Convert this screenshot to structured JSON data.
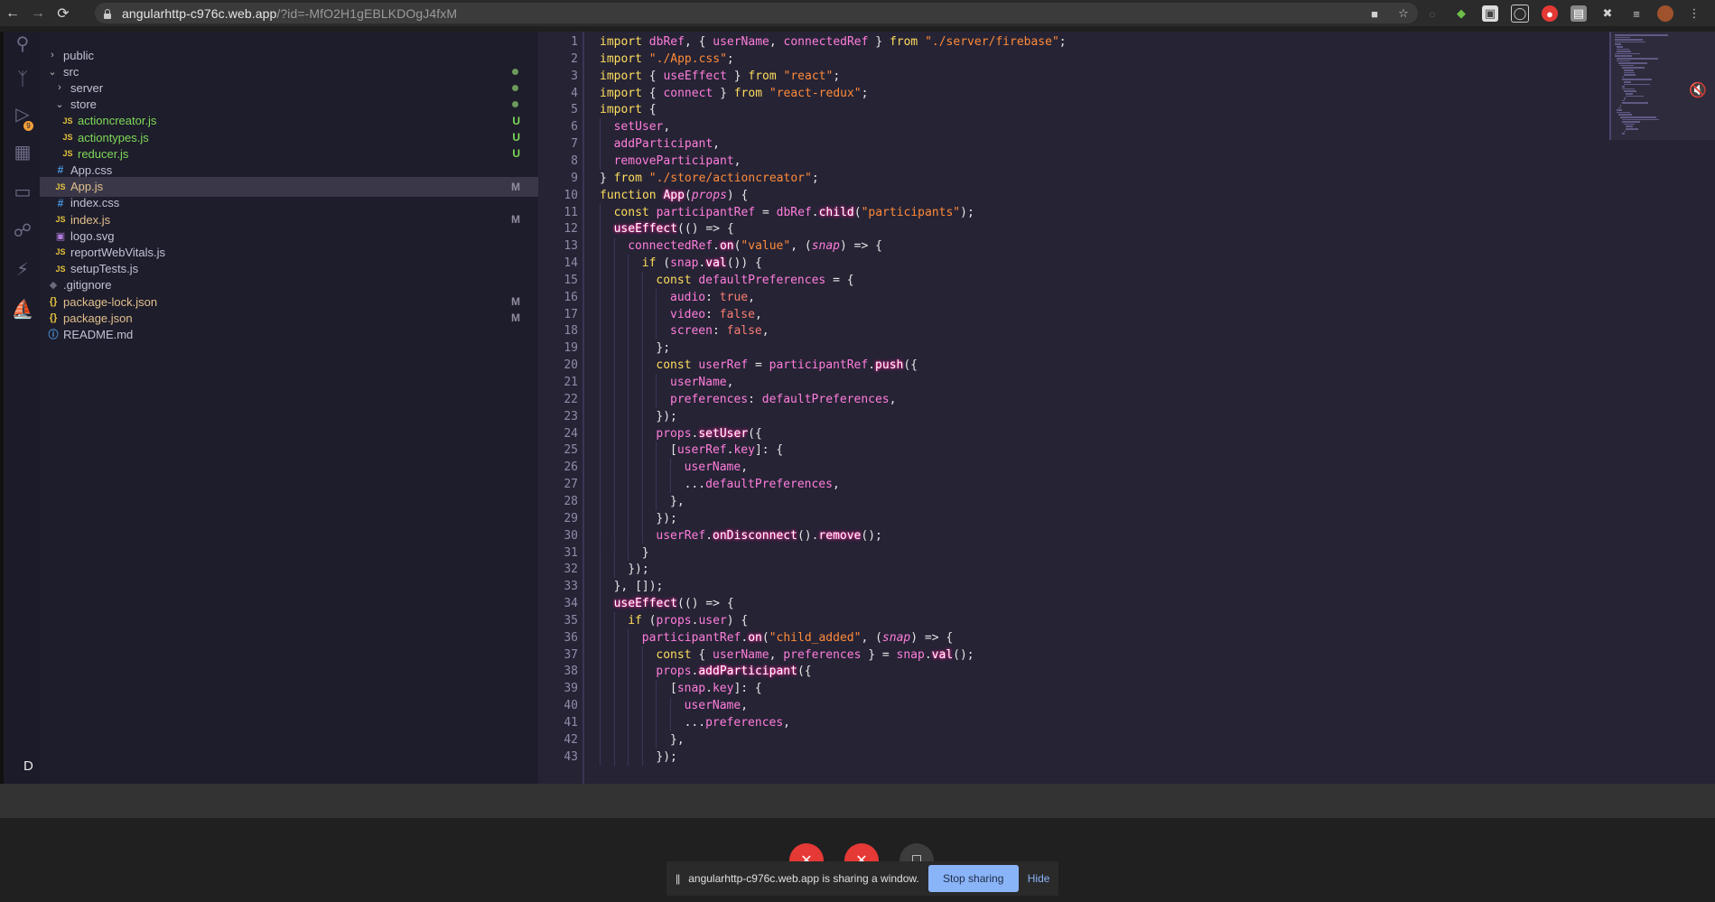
{
  "browser": {
    "url_host": "angularhttp-c976c.web.app",
    "url_path": "/?id=-MfO2H1gEBLKDOgJ4fxM"
  },
  "activity_bar": {
    "scm_badge": "9",
    "account_letter": "D"
  },
  "explorer": {
    "items": [
      {
        "label": "public",
        "type": "folder",
        "collapsed": true,
        "indent": 0,
        "status": ""
      },
      {
        "label": "src",
        "type": "folder",
        "collapsed": false,
        "indent": 0,
        "status": "dot"
      },
      {
        "label": "server",
        "type": "folder",
        "collapsed": true,
        "indent": 1,
        "status": "dot"
      },
      {
        "label": "store",
        "type": "folder",
        "collapsed": false,
        "indent": 1,
        "status": "dot"
      },
      {
        "label": "actioncreator.js",
        "type": "js",
        "indent": 2,
        "status": "U"
      },
      {
        "label": "actiontypes.js",
        "type": "js",
        "indent": 2,
        "status": "U"
      },
      {
        "label": "reducer.js",
        "type": "js",
        "indent": 2,
        "status": "U"
      },
      {
        "label": "App.css",
        "type": "css",
        "indent": 1,
        "status": ""
      },
      {
        "label": "App.js",
        "type": "js",
        "indent": 1,
        "status": "M",
        "active": true
      },
      {
        "label": "index.css",
        "type": "css",
        "indent": 1,
        "status": ""
      },
      {
        "label": "index.js",
        "type": "js",
        "indent": 1,
        "status": "M"
      },
      {
        "label": "logo.svg",
        "type": "svg",
        "indent": 1,
        "status": ""
      },
      {
        "label": "reportWebVitals.js",
        "type": "js",
        "indent": 1,
        "status": ""
      },
      {
        "label": "setupTests.js",
        "type": "js",
        "indent": 1,
        "status": ""
      },
      {
        "label": ".gitignore",
        "type": "git",
        "indent": 0,
        "status": ""
      },
      {
        "label": "package-lock.json",
        "type": "json",
        "indent": 0,
        "status": "M"
      },
      {
        "label": "package.json",
        "type": "json",
        "indent": 0,
        "status": "M"
      },
      {
        "label": "README.md",
        "type": "info",
        "indent": 0,
        "status": ""
      }
    ]
  },
  "editor": {
    "lines": [
      {
        "n": "1",
        "indent": 0,
        "tokens": [
          [
            "kw",
            "import "
          ],
          [
            "var",
            "dbRef"
          ],
          [
            "punc",
            ", { "
          ],
          [
            "var",
            "userName"
          ],
          [
            "punc",
            ", "
          ],
          [
            "var",
            "connectedRef"
          ],
          [
            "punc",
            " } "
          ],
          [
            "kw",
            "from "
          ],
          [
            "str",
            "\"./server/firebase\""
          ],
          [
            "punc",
            ";"
          ]
        ]
      },
      {
        "n": "2",
        "indent": 0,
        "tokens": [
          [
            "kw",
            "import "
          ],
          [
            "str",
            "\"./App.css\""
          ],
          [
            "punc",
            ";"
          ]
        ]
      },
      {
        "n": "3",
        "indent": 0,
        "tokens": [
          [
            "kw",
            "import "
          ],
          [
            "punc",
            "{ "
          ],
          [
            "var",
            "useEffect"
          ],
          [
            "punc",
            " } "
          ],
          [
            "kw",
            "from "
          ],
          [
            "str",
            "\"react\""
          ],
          [
            "punc",
            ";"
          ]
        ]
      },
      {
        "n": "4",
        "indent": 0,
        "tokens": [
          [
            "kw",
            "import "
          ],
          [
            "punc",
            "{ "
          ],
          [
            "var",
            "connect"
          ],
          [
            "punc",
            " } "
          ],
          [
            "kw",
            "from "
          ],
          [
            "str",
            "\"react-redux\""
          ],
          [
            "punc",
            ";"
          ]
        ]
      },
      {
        "n": "5",
        "indent": 0,
        "tokens": [
          [
            "kw",
            "import "
          ],
          [
            "punc",
            "{"
          ]
        ]
      },
      {
        "n": "6",
        "indent": 1,
        "tokens": [
          [
            "var",
            "setUser"
          ],
          [
            "punc",
            ","
          ]
        ]
      },
      {
        "n": "7",
        "indent": 1,
        "tokens": [
          [
            "var",
            "addParticipant"
          ],
          [
            "punc",
            ","
          ]
        ]
      },
      {
        "n": "8",
        "indent": 1,
        "tokens": [
          [
            "var",
            "removeParticipant"
          ],
          [
            "punc",
            ","
          ]
        ]
      },
      {
        "n": "9",
        "indent": 0,
        "tokens": [
          [
            "punc",
            "} "
          ],
          [
            "kw",
            "from "
          ],
          [
            "str",
            "\"./store/actioncreator\""
          ],
          [
            "punc",
            ";"
          ]
        ]
      },
      {
        "n": "10",
        "indent": 0,
        "tokens": [
          [
            "kw",
            "function "
          ],
          [
            "glow",
            "App"
          ],
          [
            "punc",
            "("
          ],
          [
            "par",
            "props"
          ],
          [
            "punc",
            ") {"
          ]
        ]
      },
      {
        "n": "11",
        "indent": 1,
        "tokens": [
          [
            "kw",
            "const "
          ],
          [
            "var",
            "participantRef"
          ],
          [
            "punc",
            " = "
          ],
          [
            "var",
            "dbRef"
          ],
          [
            "punc",
            "."
          ],
          [
            "glow",
            "child"
          ],
          [
            "punc",
            "("
          ],
          [
            "str",
            "\"participants\""
          ],
          [
            "punc",
            ");"
          ]
        ]
      },
      {
        "n": "12",
        "indent": 1,
        "tokens": [
          [
            "glow",
            "useEffect"
          ],
          [
            "punc",
            "(() => {"
          ]
        ]
      },
      {
        "n": "13",
        "indent": 2,
        "tokens": [
          [
            "var",
            "connectedRef"
          ],
          [
            "punc",
            "."
          ],
          [
            "glow",
            "on"
          ],
          [
            "punc",
            "("
          ],
          [
            "str",
            "\"value\""
          ],
          [
            "punc",
            ", ("
          ],
          [
            "par",
            "snap"
          ],
          [
            "punc",
            ") => {"
          ]
        ]
      },
      {
        "n": "14",
        "indent": 3,
        "tokens": [
          [
            "kw",
            "if "
          ],
          [
            "punc",
            "("
          ],
          [
            "var",
            "snap"
          ],
          [
            "punc",
            "."
          ],
          [
            "glow",
            "val"
          ],
          [
            "punc",
            "()) {"
          ]
        ]
      },
      {
        "n": "15",
        "indent": 4,
        "tokens": [
          [
            "kw",
            "const "
          ],
          [
            "var",
            "defaultPreferences"
          ],
          [
            "punc",
            " = {"
          ]
        ]
      },
      {
        "n": "16",
        "indent": 5,
        "tokens": [
          [
            "prop",
            "audio"
          ],
          [
            "punc",
            ": "
          ],
          [
            "lit",
            "true"
          ],
          [
            "punc",
            ","
          ]
        ]
      },
      {
        "n": "17",
        "indent": 5,
        "tokens": [
          [
            "prop",
            "video"
          ],
          [
            "punc",
            ": "
          ],
          [
            "lit",
            "false"
          ],
          [
            "punc",
            ","
          ]
        ]
      },
      {
        "n": "18",
        "indent": 5,
        "tokens": [
          [
            "prop",
            "screen"
          ],
          [
            "punc",
            ": "
          ],
          [
            "lit",
            "false"
          ],
          [
            "punc",
            ","
          ]
        ]
      },
      {
        "n": "19",
        "indent": 4,
        "tokens": [
          [
            "punc",
            "};"
          ]
        ]
      },
      {
        "n": "20",
        "indent": 4,
        "tokens": [
          [
            "kw",
            "const "
          ],
          [
            "var",
            "userRef"
          ],
          [
            "punc",
            " = "
          ],
          [
            "var",
            "participantRef"
          ],
          [
            "punc",
            "."
          ],
          [
            "glow",
            "push"
          ],
          [
            "punc",
            "({"
          ]
        ]
      },
      {
        "n": "21",
        "indent": 5,
        "tokens": [
          [
            "var",
            "userName"
          ],
          [
            "punc",
            ","
          ]
        ]
      },
      {
        "n": "22",
        "indent": 5,
        "tokens": [
          [
            "prop",
            "preferences"
          ],
          [
            "punc",
            ": "
          ],
          [
            "var",
            "defaultPreferences"
          ],
          [
            "punc",
            ","
          ]
        ]
      },
      {
        "n": "23",
        "indent": 4,
        "tokens": [
          [
            "punc",
            "});"
          ]
        ]
      },
      {
        "n": "24",
        "indent": 4,
        "tokens": [
          [
            "var",
            "props"
          ],
          [
            "punc",
            "."
          ],
          [
            "glow",
            "setUser"
          ],
          [
            "punc",
            "({"
          ]
        ]
      },
      {
        "n": "25",
        "indent": 5,
        "tokens": [
          [
            "punc",
            "["
          ],
          [
            "var",
            "userRef"
          ],
          [
            "punc",
            "."
          ],
          [
            "var",
            "key"
          ],
          [
            "punc",
            "]: {"
          ]
        ]
      },
      {
        "n": "26",
        "indent": 6,
        "tokens": [
          [
            "var",
            "userName"
          ],
          [
            "punc",
            ","
          ]
        ]
      },
      {
        "n": "27",
        "indent": 6,
        "tokens": [
          [
            "punc",
            "..."
          ],
          [
            "var",
            "defaultPreferences"
          ],
          [
            "punc",
            ","
          ]
        ]
      },
      {
        "n": "28",
        "indent": 5,
        "tokens": [
          [
            "punc",
            "},"
          ]
        ]
      },
      {
        "n": "29",
        "indent": 4,
        "tokens": [
          [
            "punc",
            "});"
          ]
        ]
      },
      {
        "n": "30",
        "indent": 4,
        "tokens": [
          [
            "var",
            "userRef"
          ],
          [
            "punc",
            "."
          ],
          [
            "glow",
            "onDisconnect"
          ],
          [
            "punc",
            "()."
          ],
          [
            "glow",
            "remove"
          ],
          [
            "punc",
            "();"
          ]
        ]
      },
      {
        "n": "31",
        "indent": 3,
        "tokens": [
          [
            "punc",
            "}"
          ]
        ]
      },
      {
        "n": "32",
        "indent": 2,
        "tokens": [
          [
            "punc",
            "});"
          ]
        ]
      },
      {
        "n": "33",
        "indent": 1,
        "tokens": [
          [
            "punc",
            "}, []);"
          ]
        ]
      },
      {
        "n": "34",
        "indent": 1,
        "tokens": [
          [
            "glow",
            "useEffect"
          ],
          [
            "punc",
            "(() => {"
          ]
        ]
      },
      {
        "n": "35",
        "indent": 2,
        "tokens": [
          [
            "kw",
            "if "
          ],
          [
            "punc",
            "("
          ],
          [
            "var",
            "props"
          ],
          [
            "punc",
            "."
          ],
          [
            "var",
            "user"
          ],
          [
            "punc",
            ") {"
          ]
        ]
      },
      {
        "n": "36",
        "indent": 3,
        "tokens": [
          [
            "var",
            "participantRef"
          ],
          [
            "punc",
            "."
          ],
          [
            "glow",
            "on"
          ],
          [
            "punc",
            "("
          ],
          [
            "str",
            "\"child_added\""
          ],
          [
            "punc",
            ", ("
          ],
          [
            "par",
            "snap"
          ],
          [
            "punc",
            ") => {"
          ]
        ]
      },
      {
        "n": "37",
        "indent": 4,
        "tokens": [
          [
            "kw",
            "const "
          ],
          [
            "punc",
            "{ "
          ],
          [
            "var",
            "userName"
          ],
          [
            "punc",
            ", "
          ],
          [
            "var",
            "preferences"
          ],
          [
            "punc",
            " } = "
          ],
          [
            "var",
            "snap"
          ],
          [
            "punc",
            "."
          ],
          [
            "glow",
            "val"
          ],
          [
            "punc",
            "();"
          ]
        ]
      },
      {
        "n": "38",
        "indent": 4,
        "tokens": [
          [
            "var",
            "props"
          ],
          [
            "punc",
            "."
          ],
          [
            "glow",
            "addParticipant"
          ],
          [
            "punc",
            "({"
          ]
        ]
      },
      {
        "n": "39",
        "indent": 5,
        "tokens": [
          [
            "punc",
            "["
          ],
          [
            "var",
            "snap"
          ],
          [
            "punc",
            "."
          ],
          [
            "var",
            "key"
          ],
          [
            "punc",
            "]: {"
          ]
        ]
      },
      {
        "n": "40",
        "indent": 6,
        "tokens": [
          [
            "var",
            "userName"
          ],
          [
            "punc",
            ","
          ]
        ]
      },
      {
        "n": "41",
        "indent": 6,
        "tokens": [
          [
            "punc",
            "..."
          ],
          [
            "var",
            "preferences"
          ],
          [
            "punc",
            ","
          ]
        ]
      },
      {
        "n": "42",
        "indent": 5,
        "tokens": [
          [
            "punc",
            "},"
          ]
        ]
      },
      {
        "n": "43",
        "indent": 4,
        "tokens": [
          [
            "punc",
            "});"
          ]
        ]
      }
    ]
  },
  "share_bar": {
    "pause_glyph": "||",
    "message": "angularhttp-c976c.web.app is sharing a window.",
    "stop_label": "Stop sharing",
    "hide_label": "Hide"
  },
  "colors": {
    "accent": "#8ab4f8",
    "end_call": "#e53935"
  }
}
